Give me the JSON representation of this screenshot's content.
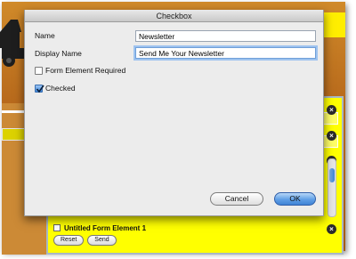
{
  "dialog": {
    "title": "Checkbox",
    "name_label": "Name",
    "name_value": "Newsletter",
    "display_name_label": "Display Name",
    "display_name_value": "Send Me Your Newsletter",
    "form_element_required_label": "Form Element Required",
    "form_element_required_checked": false,
    "checked_label": "Checked",
    "checked_checked": true,
    "cancel_label": "Cancel",
    "ok_label": "OK"
  },
  "background": {
    "form_element_label": "Untitled Form Element 1",
    "reset_label": "Reset",
    "send_label": "Send",
    "close_glyph": "×"
  },
  "colors": {
    "panel_yellow": "#ffff00",
    "background_brown": "#b86a1c",
    "accent_blue": "#3f83d5"
  },
  "icons": [
    "close-icon",
    "checkmark-icon",
    "car-logo-icon"
  ]
}
